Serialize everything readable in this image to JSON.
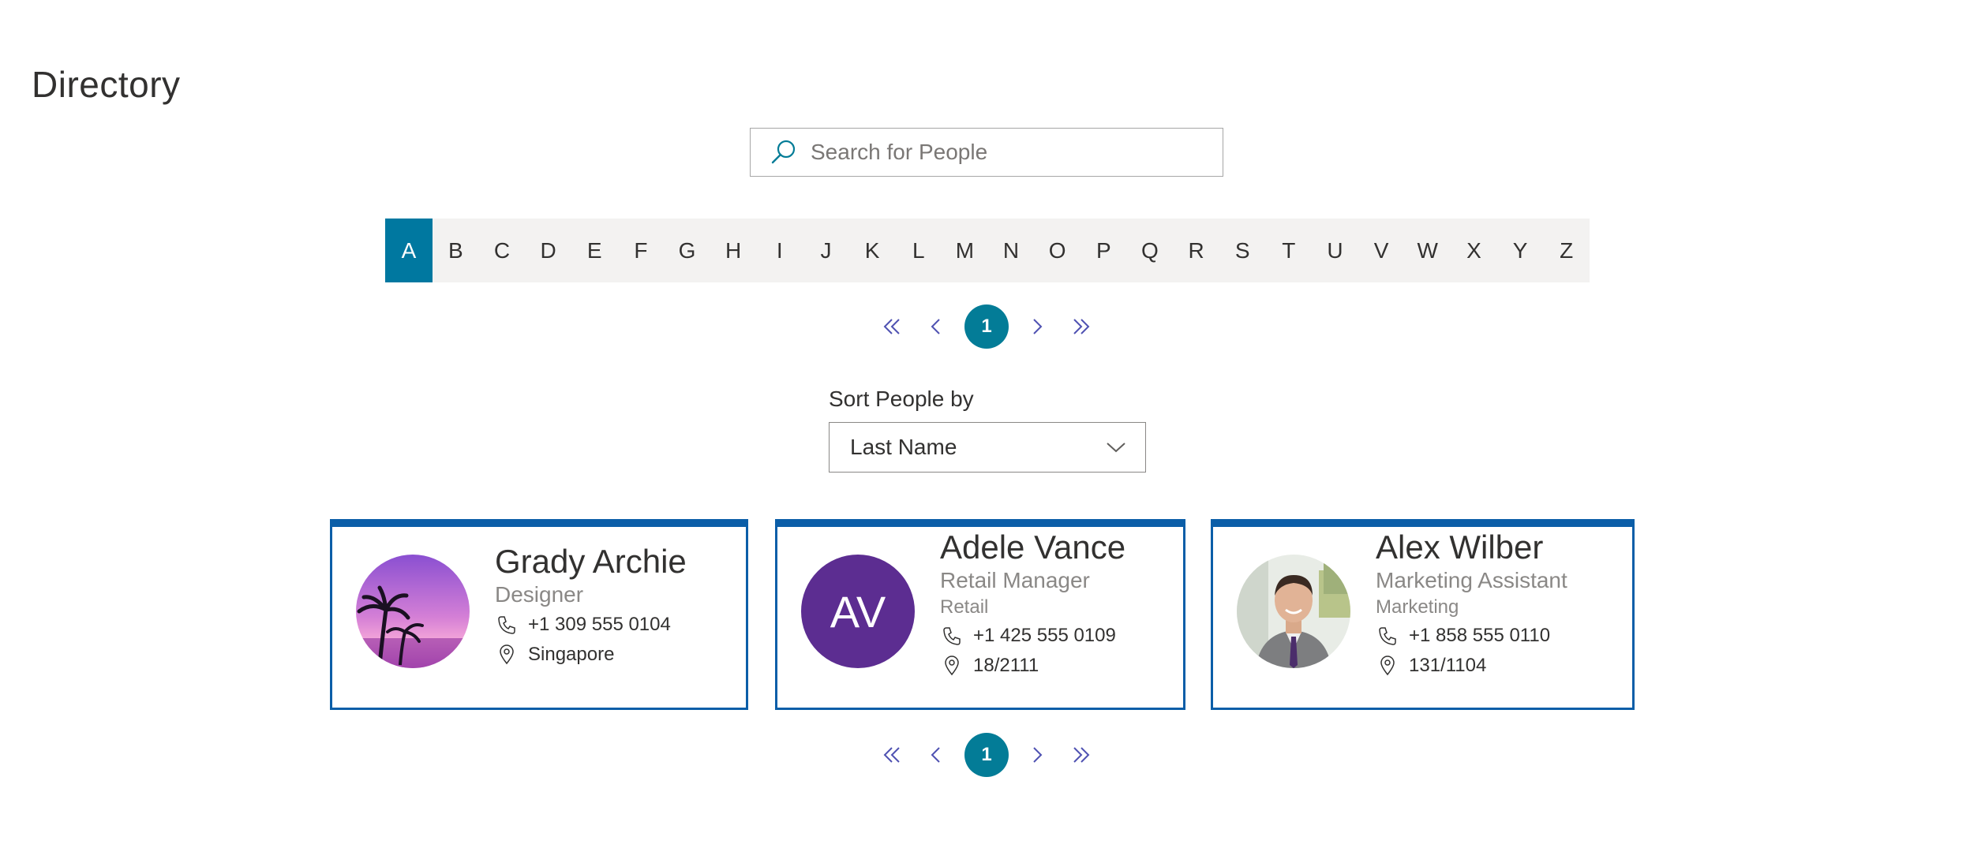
{
  "page": {
    "title": "Directory"
  },
  "search": {
    "placeholder": "Search for People"
  },
  "alphabet": {
    "letters": [
      "A",
      "B",
      "C",
      "D",
      "E",
      "F",
      "G",
      "H",
      "I",
      "J",
      "K",
      "L",
      "M",
      "N",
      "O",
      "P",
      "Q",
      "R",
      "S",
      "T",
      "U",
      "V",
      "W",
      "X",
      "Y",
      "Z"
    ],
    "selected": "A"
  },
  "pager_top": {
    "current_page": "1"
  },
  "pager_bottom": {
    "current_page": "1"
  },
  "sort": {
    "label": "Sort People by",
    "selected": "Last Name"
  },
  "people": [
    {
      "name": "Grady Archie",
      "job_title": "Designer",
      "department": "",
      "phone": "+1 309 555 0104",
      "location": "Singapore",
      "avatar": "photo-sunset-palm-icon"
    },
    {
      "name": "Adele Vance",
      "job_title": "Retail Manager",
      "department": "Retail",
      "phone": "+1 425 555 0109",
      "location": "18/2111",
      "initials": "AV",
      "avatar_color": "#5c2d91"
    },
    {
      "name": "Alex Wilber",
      "job_title": "Marketing Assistant",
      "department": "Marketing",
      "phone": "+1 858 555 0110",
      "location": "131/1104",
      "avatar": "photo-man-portrait-icon"
    }
  ],
  "colors": {
    "accent": "#037c97",
    "alpha_active": "#0078a0",
    "card_border": "#0b5ea8",
    "pager_arrows": "#4f52b2"
  }
}
